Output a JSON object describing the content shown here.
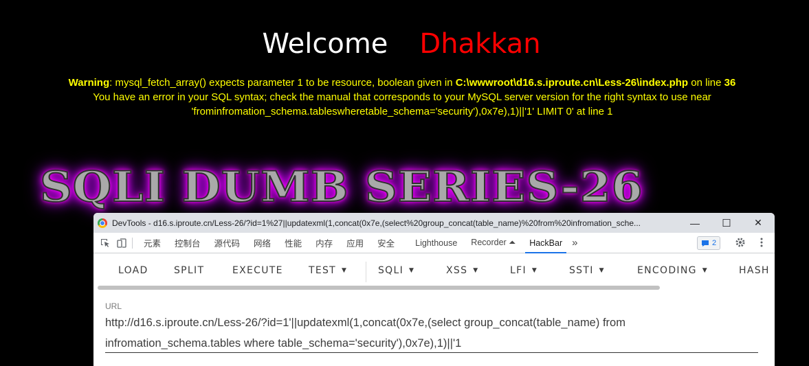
{
  "page": {
    "welcome_word": "Welcome",
    "welcome_name": "Dhakkan",
    "warning_label": "Warning",
    "warning_text": ": mysql_fetch_array() expects parameter 1 to be resource, boolean given in ",
    "warning_path": "C:\\wwwroot\\d16.s.iproute.cn\\Less-26\\index.php",
    "warning_online": " on line ",
    "warning_line": "36",
    "sql_error_1": "You have an error in your SQL syntax; check the manual that corresponds to your MySQL server version for the right syntax to use near",
    "sql_error_2": "'frominfromation_schema.tableswheretable_schema='security'),0x7e),1)||'1' LIMIT 0' at line 1",
    "banner": "SQLI DUMB SERIES-26"
  },
  "devtools": {
    "window_title": "DevTools - d16.s.iproute.cn/Less-26/?id=1%27||updatexml(1,concat(0x7e,(select%20group_concat(table_name)%20from%20infromation_sche...",
    "minimize": "—",
    "maximize": "☐",
    "close": "✕",
    "tabs": [
      "元素",
      "控制台",
      "源代码",
      "网络",
      "性能",
      "内存",
      "应用",
      "安全",
      "Lighthouse",
      "Recorder ⏶",
      "HackBar"
    ],
    "more_tabs": "»",
    "issues_count": "2"
  },
  "hackbar": {
    "buttons": [
      "LOAD",
      "SPLIT",
      "EXECUTE",
      "TEST",
      "SQLI",
      "XSS",
      "LFI",
      "SSTI",
      "ENCODING",
      "HASH"
    ],
    "url_label": "URL",
    "url_value_line1": "http://d16.s.iproute.cn/Less-26/?id=1'||updatexml(1,concat(0x7e,(select group_concat(table_name) from",
    "url_value_line2": "infromation_schema.tables where table_schema='security'),0x7e),1)||'1"
  },
  "colors": {
    "accent_name": "#ff0000",
    "warning_text": "#ffff00",
    "banner_glow": "#ff00ff",
    "active_tab": "#1a73e8"
  }
}
